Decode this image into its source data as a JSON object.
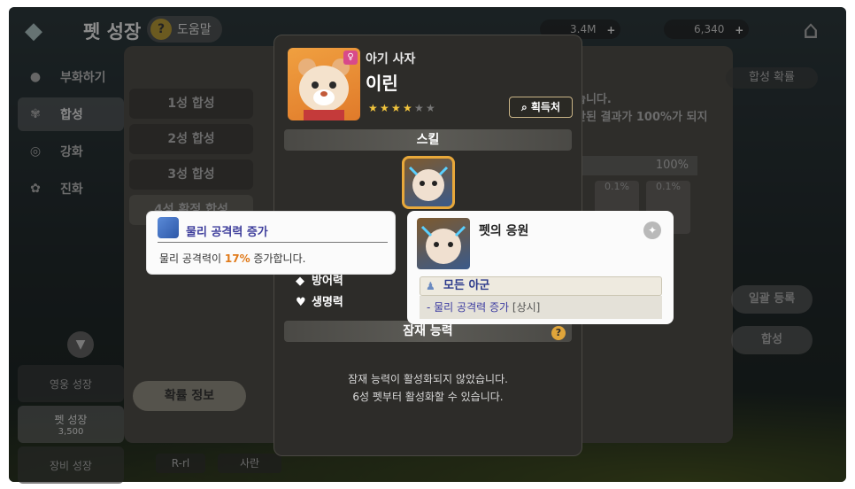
{
  "header": {
    "title": "펫 성장",
    "help_label": "도움말",
    "currency1": "3.4M",
    "currency2": "6,340"
  },
  "sidebar": {
    "items": [
      {
        "label": "부화하기",
        "icon": "egg-icon"
      },
      {
        "label": "합성",
        "icon": "paw-icon",
        "active": true
      },
      {
        "label": "강화",
        "icon": "enhance-icon"
      },
      {
        "label": "진화",
        "icon": "evolve-icon"
      }
    ]
  },
  "bottom_tabs": [
    {
      "label": "영웅 성장"
    },
    {
      "label": "펫 성장",
      "sub": "3,500",
      "active": true
    },
    {
      "label": "장비 성장"
    }
  ],
  "bg_panel": {
    "tabs": [
      "1성 합성",
      "2성 합성",
      "3성 합성",
      "4성 확정 합성"
    ],
    "prob_info_label": "확률 정보",
    "desc_line1": "습니다.",
    "desc_line2": "반된 결과가 100%가 되지",
    "percent_total": "100%",
    "mini_card1": "0.1%",
    "mini_card2": "0.1%",
    "top_right_button": "합성 확률",
    "register_all": "일괄 등록",
    "synthesize": "합성",
    "bottom_tag1": "R-rl",
    "bottom_tag2": "사란"
  },
  "popup": {
    "species": "아기 사자",
    "name": "이린",
    "stars_filled": 4,
    "stars_total": 6,
    "obtain_label": "획득처",
    "skill_header": "스킬",
    "stats": [
      {
        "label": "방어력",
        "icon": "shield-icon"
      },
      {
        "label": "생명력",
        "icon": "heart-icon"
      }
    ],
    "potential_header": "잠재 능력",
    "potential_msg1": "잠재 능력이 활성화되지 않았습니다.",
    "potential_msg2": "6성 펫부터 활성화할 수 있습니다."
  },
  "tooltip_stat": {
    "title": "물리 공격력 증가",
    "desc_prefix": "물리 공격력이 ",
    "desc_value": "17%",
    "desc_suffix": " 증가합니다."
  },
  "tooltip_skill": {
    "title": "펫의 응원",
    "target": "모든 아군",
    "effect": "- 물리 공격력 증가",
    "effect_tag": "[상시]"
  },
  "colors": {
    "accent_orange": "#e07a1a",
    "gold_border": "#e8a83a",
    "link_blue": "#3f3f9c"
  }
}
